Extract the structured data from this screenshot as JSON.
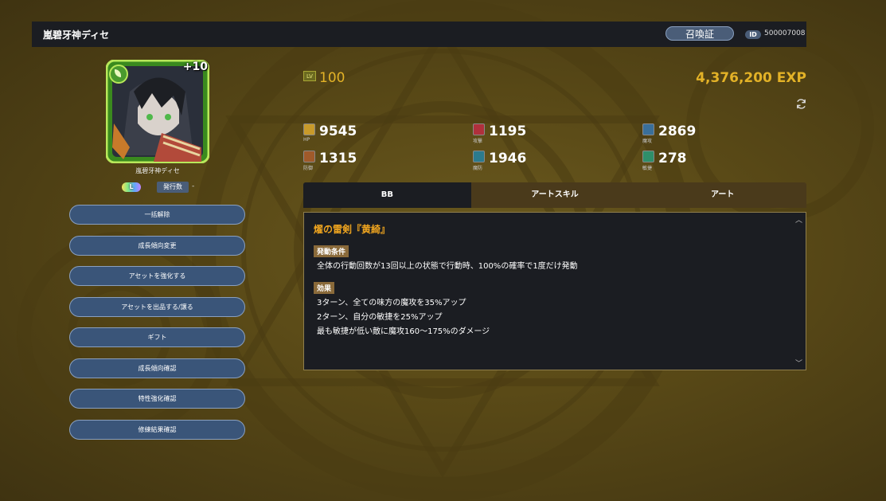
{
  "header": {
    "unit_name": "嵐碧牙神ディセ",
    "summon_button": "召喚証",
    "id_label": "ID",
    "id_value": "500007008"
  },
  "portrait": {
    "plus_level": "+10",
    "element_icon": "leaf-icon"
  },
  "unit": {
    "name": "嵐碧牙神ディセ",
    "rarity": "L",
    "issue_label": "発行数",
    "issue_value": "-"
  },
  "actions": [
    {
      "label": "一括解除"
    },
    {
      "label": "成長傾向変更"
    },
    {
      "label": "アセットを強化する"
    },
    {
      "label": "アセットを出品する/譲る"
    },
    {
      "label": "ギフト"
    },
    {
      "label": "成長傾向確認"
    },
    {
      "label": "特性強化確認"
    },
    {
      "label": "修練結果確認"
    }
  ],
  "level": {
    "icon_text": "LV",
    "value": "100"
  },
  "exp": "4,376,200 EXP",
  "stats": [
    {
      "key": "hp",
      "label": "HP",
      "value": "9545",
      "color": "#c89a2a"
    },
    {
      "key": "atk",
      "label": "攻撃",
      "value": "1195",
      "color": "#b0303c"
    },
    {
      "key": "matk",
      "label": "魔攻",
      "value": "2869",
      "color": "#3a6f9a"
    },
    {
      "key": "def",
      "label": "防御",
      "value": "1315",
      "color": "#a05a2a"
    },
    {
      "key": "mdef",
      "label": "魔防",
      "value": "1946",
      "color": "#2c7b8e"
    },
    {
      "key": "agi",
      "label": "敏捷",
      "value": "278",
      "color": "#2f8f6a"
    }
  ],
  "tabs": [
    {
      "label": "BB",
      "active": true
    },
    {
      "label": "アートスキル",
      "active": false
    },
    {
      "label": "アート",
      "active": false
    }
  ],
  "skill": {
    "title": "燿の雷剣『黄綺』",
    "condition_tag": "発動条件",
    "condition_text": "全体の行動回数が13回以上の状態で行動時、100%の確率で1度だけ発動",
    "effect_tag": "効果",
    "effects": [
      "3ターン、全ての味方の魔攻を35%アップ",
      "2ターン、自分の敏捷を25%アップ",
      "最も敏捷が低い敵に魔攻160～175%のダメージ"
    ]
  },
  "colors": {
    "gold": "#e3b227",
    "skill_title": "#f0a51f",
    "button": "#3a5579"
  }
}
